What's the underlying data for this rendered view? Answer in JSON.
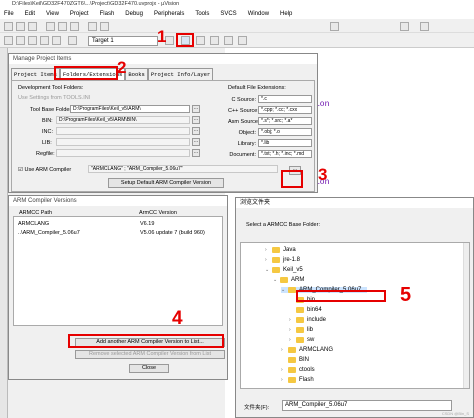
{
  "window": {
    "title": "D:\\Files\\Keil\\GD32F470ZGT6\\...\\Project\\GD32F470.uvprojx - µVision"
  },
  "menu": [
    "File",
    "Edit",
    "View",
    "Project",
    "Flash",
    "Debug",
    "Peripherals",
    "Tools",
    "SVCS",
    "Window",
    "Help"
  ],
  "toolbar": {
    "target": "Target 1"
  },
  "editor": {
    "line1": "ion",
    "line2": "ion"
  },
  "manage": {
    "title": "Manage Project Items",
    "tabs": [
      "Project Items",
      "Folders/Extensions",
      "Books",
      "Project Info/Layer"
    ],
    "dev_tools_label": "Development Tool Folders:",
    "use_settings": "Use Settings from TOOLS.INI",
    "tool_base_label": "Tool Base Folder:",
    "tool_base_value": "D:\\ProgramFiles\\Keil_v5\\ARM\\",
    "bin_label": "BIN:",
    "bin_value": "D:\\ProgramFiles\\Keil_v5\\ARM\\BIN\\",
    "inc_label": "INC:",
    "lib_label": "LIB:",
    "regfile_label": "Regfile:",
    "default_ext_label": "Default File Extensions:",
    "ext": [
      {
        "label": "C Source:",
        "value": "*.c"
      },
      {
        "label": "C++ Source:",
        "value": "*.cpp; *.cc; *.cxx"
      },
      {
        "label": "Asm Source:",
        "value": "*.s*; *.src; *.a*"
      },
      {
        "label": "Object:",
        "value": "*.obj; *.o"
      },
      {
        "label": "Library:",
        "value": "*.lib"
      },
      {
        "label": "Document:",
        "value": "*.txt; *.h; *.inc; *.md"
      }
    ],
    "use_arm_compiler": "Use ARM Compiler",
    "compiler_value": "\"ARMCLANG\" ; \"ARM_Compiler_5.06u7\"",
    "setup_default_btn": "Setup Default ARM Compiler Version"
  },
  "armcc": {
    "title": "ARM Compiler Versions",
    "col_path": "ARMCC Path",
    "col_version": "ArmCC Version",
    "rows": [
      {
        "path": "ARMCLANG",
        "version": "V6.19"
      },
      {
        "path": "..\\ARM_Compiler_5.06u7",
        "version": "V5.06 update 7 (build 960)"
      }
    ],
    "add_btn": "Add another ARM Compiler Version to List...",
    "remove_btn": "Remove selected ARM Compiler Version from List",
    "close_btn": "Close"
  },
  "browse": {
    "title": "浏览文件夹",
    "prompt": "Select a ARMCC Base Folder:",
    "tree": [
      {
        "name": "Java",
        "level": 0,
        "arrow": "›"
      },
      {
        "name": "jre-1.8",
        "level": 0,
        "arrow": "›"
      },
      {
        "name": "Keil_v5",
        "level": 0,
        "arrow": "⌄"
      },
      {
        "name": "ARM",
        "level": 1,
        "arrow": "⌄"
      },
      {
        "name": "ARM_Compiler_5.06u7",
        "level": 2,
        "arrow": "⌄",
        "selected": true
      },
      {
        "name": "bin",
        "level": 3,
        "arrow": ""
      },
      {
        "name": "bin64",
        "level": 3,
        "arrow": ""
      },
      {
        "name": "include",
        "level": 3,
        "arrow": "›"
      },
      {
        "name": "lib",
        "level": 3,
        "arrow": "›"
      },
      {
        "name": "sw",
        "level": 3,
        "arrow": "›"
      },
      {
        "name": "ARMCLANG",
        "level": 2,
        "arrow": "›"
      },
      {
        "name": "BIN",
        "level": 2,
        "arrow": ""
      },
      {
        "name": "ctools",
        "level": 2,
        "arrow": "›"
      },
      {
        "name": "Flash",
        "level": 2,
        "arrow": "›"
      }
    ],
    "folder_label": "文件夹(F):",
    "folder_value": "ARM_Compiler_5.06u7"
  },
  "annotations": [
    "1",
    "2",
    "3",
    "4",
    "5"
  ],
  "watermark": "CSDN @Bin_S"
}
